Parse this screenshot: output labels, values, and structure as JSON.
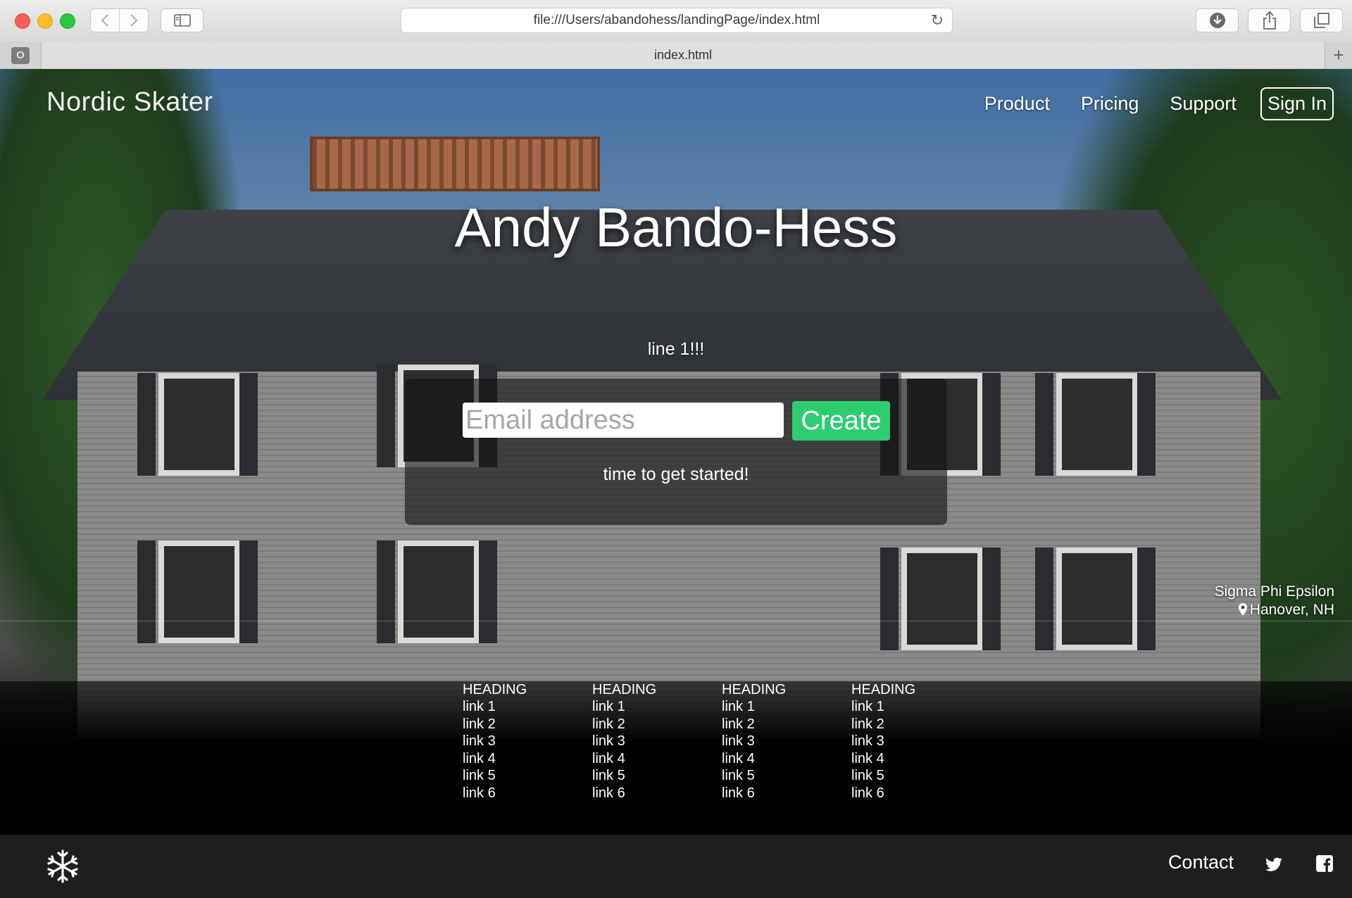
{
  "browser": {
    "url": "file:///Users/abandohess/landingPage/index.html",
    "tab_title": "index.html",
    "pinned_tab_letter": "O",
    "new_tab_symbol": "+"
  },
  "colors": {
    "accent_green": "#2ecc71",
    "footer_bg": "#1e1e1e",
    "box_bg": "rgba(20,20,20,0.62)"
  },
  "header": {
    "brand": "Nordic Skater",
    "nav": [
      "Product",
      "Pricing",
      "Support"
    ],
    "signin_label": "Sign In"
  },
  "hero": {
    "title": "Andy Bando-Hess",
    "line": "line 1!!!",
    "email_placeholder": "Email address",
    "create_label": "Create",
    "tagline": "time to get started!"
  },
  "location": {
    "name": "Sigma Phi Epsilon",
    "city": "Hanover, NH",
    "icon": "map-pin-icon"
  },
  "footer_columns": [
    {
      "heading": "HEADING",
      "links": [
        "link 1",
        "link 2",
        "link 3",
        "link 4",
        "link 5",
        "link 6"
      ]
    },
    {
      "heading": "HEADING",
      "links": [
        "link 1",
        "link 2",
        "link 3",
        "link 4",
        "link 5",
        "link 6"
      ]
    },
    {
      "heading": "HEADING",
      "links": [
        "link 1",
        "link 2",
        "link 3",
        "link 4",
        "link 5",
        "link 6"
      ]
    },
    {
      "heading": "HEADING",
      "links": [
        "link 1",
        "link 2",
        "link 3",
        "link 4",
        "link 5",
        "link 6"
      ]
    }
  ],
  "footer": {
    "logo_icon": "snowflake-icon",
    "contact_label": "Contact",
    "social_icons": [
      "twitter-icon",
      "facebook-icon"
    ]
  }
}
